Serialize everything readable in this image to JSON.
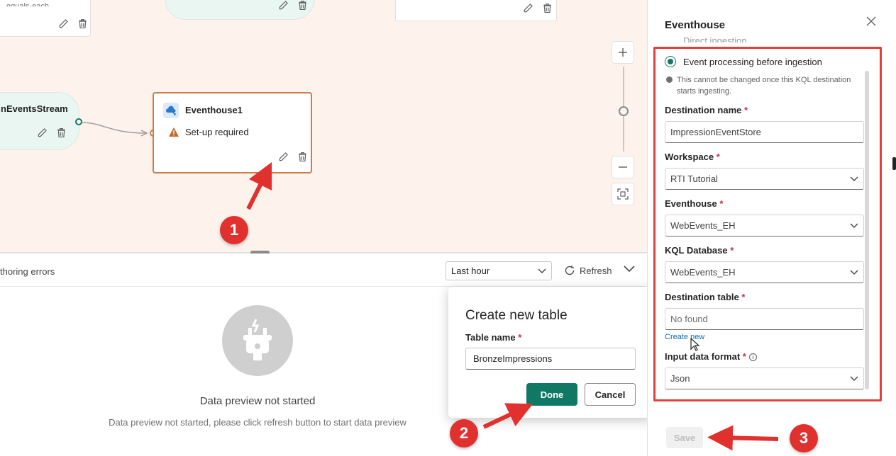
{
  "canvas": {
    "top_node_partial_text": "nEventsStream",
    "top_left_partial_text": "equals-each",
    "destination_node": {
      "title": "Eventhouse1",
      "status": "Set-up required"
    }
  },
  "bottom_panel": {
    "errors_tab": "thoring errors",
    "time_range": "Last hour",
    "refresh_label": "Refresh",
    "empty_title": "Data preview not started",
    "empty_subtitle": "Data preview not started, please click refresh button to start data preview"
  },
  "dialog": {
    "title": "Create new table",
    "field_label": "Table name",
    "field_value": "BronzeImpressions",
    "done_label": "Done",
    "cancel_label": "Cancel"
  },
  "side_panel": {
    "title": "Eventhouse",
    "cut_option": "Direct ingestion",
    "selected_option": "Event processing before ingestion",
    "note": "This cannot be changed once this KQL destination starts ingesting.",
    "fields": {
      "destination_name": {
        "label": "Destination name",
        "value": "ImpressionEventStore"
      },
      "workspace": {
        "label": "Workspace",
        "value": "RTI Tutorial"
      },
      "eventhouse": {
        "label": "Eventhouse",
        "value": "WebEvents_EH"
      },
      "kql_database": {
        "label": "KQL Database",
        "value": "WebEvents_EH"
      },
      "destination_table": {
        "label": "Destination table",
        "placeholder": "No found"
      },
      "input_format": {
        "label": "Input data format",
        "value": "Json"
      }
    },
    "create_new_link": "Create new",
    "save_label": "Save",
    "required_mark": "*"
  },
  "annotations": {
    "step1": "1",
    "step2": "2",
    "step3": "3"
  },
  "colors": {
    "accent": "#117865",
    "annotation": "#e0312e",
    "canvas_bg": "#fdf3ec"
  }
}
